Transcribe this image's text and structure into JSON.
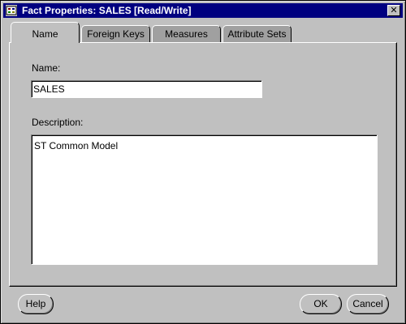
{
  "window": {
    "title": "Fact Properties: SALES [Read/Write]",
    "close_label": "✕"
  },
  "tabs": [
    {
      "label": "Name",
      "active": true
    },
    {
      "label": "Foreign Keys",
      "active": false
    },
    {
      "label": "Measures",
      "active": false
    },
    {
      "label": "Attribute Sets",
      "active": false
    }
  ],
  "name_field": {
    "label": "Name:",
    "value": "SALES"
  },
  "description_field": {
    "label": "Description:",
    "value": "ST Common Model"
  },
  "buttons": {
    "help": "Help",
    "ok": "OK",
    "cancel": "Cancel"
  },
  "colors": {
    "titlebar": "#000080",
    "face": "#c0c0c0",
    "inactive_tab": "#a0a0a0"
  }
}
